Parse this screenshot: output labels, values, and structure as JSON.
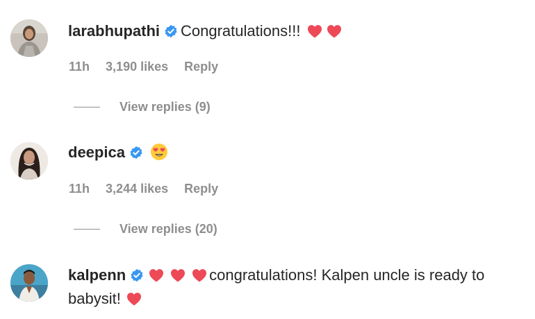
{
  "comments": [
    {
      "username": "larabhupathi",
      "text": "Congratulations!!!",
      "time": "11h",
      "likes": "3,190 likes",
      "reply": "Reply",
      "view_replies": "View replies (9)"
    },
    {
      "username": "deepica",
      "text": "",
      "time": "11h",
      "likes": "3,244 likes",
      "reply": "Reply",
      "view_replies": "View replies (20)"
    },
    {
      "username": "kalpenn",
      "text": "congratulations! Kalpen uncle is ready to babysit!",
      "text_a": "congratulations! Kalpen uncle is ready to",
      "text_b": "babysit!"
    }
  ],
  "colors": {
    "verified": "#3897f0",
    "heart": "#ed4956",
    "meta_text": "#8e8e8e"
  },
  "icons": [
    "verified-badge-icon",
    "red-heart-icon",
    "heart-eyes-emoji-icon"
  ]
}
